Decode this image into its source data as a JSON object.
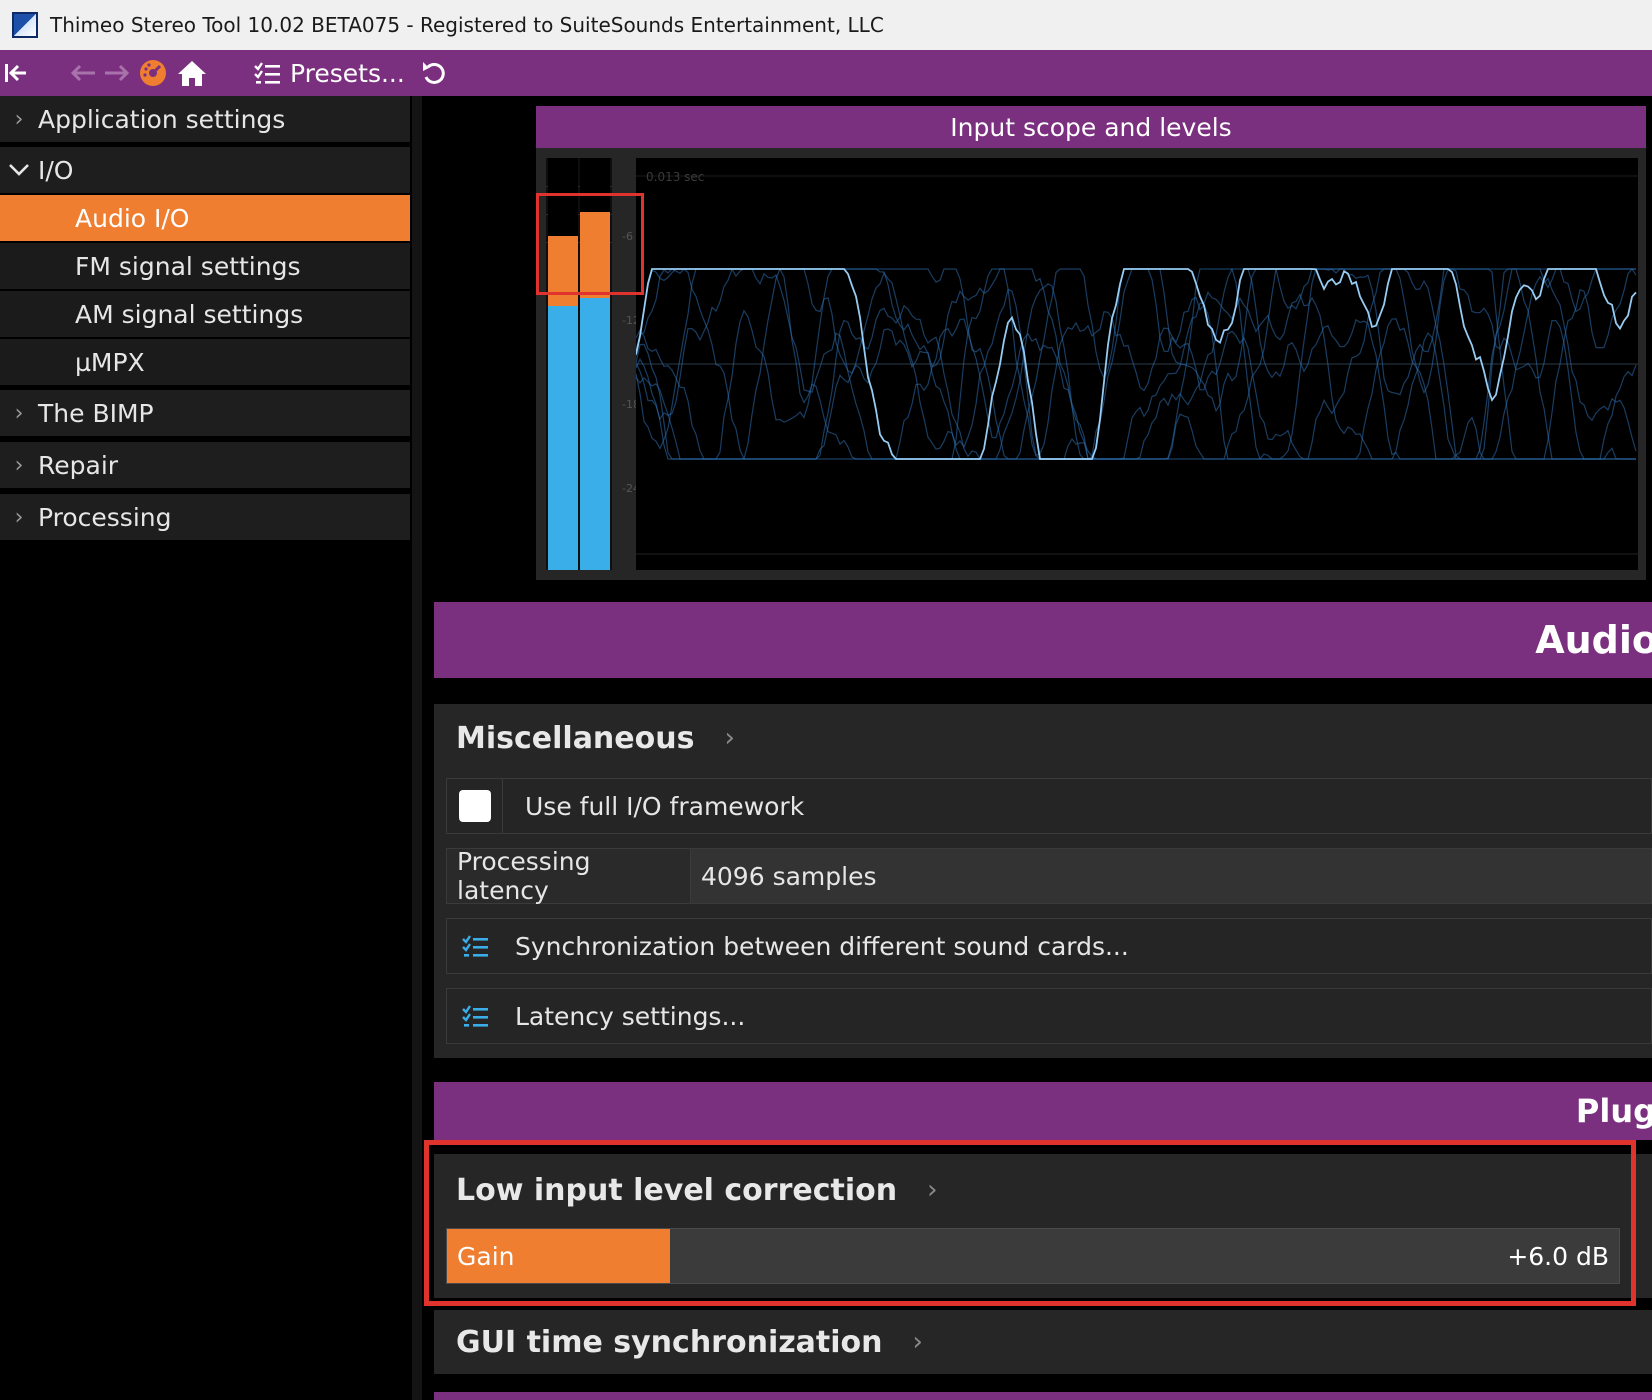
{
  "window": {
    "title": "Thimeo Stereo Tool 10.02 BETA075 - Registered to SuiteSounds Entertainment, LLC"
  },
  "toolbar": {
    "presets_label": "Presets...",
    "icons": [
      "collapse-left-icon",
      "back-arrow-icon",
      "forward-arrow-icon",
      "dial-icon",
      "home-icon",
      "list-icon",
      "undo-icon"
    ]
  },
  "sidebar": {
    "items": [
      {
        "label": "Application settings",
        "expanded": false
      },
      {
        "label": "I/O",
        "expanded": true
      },
      {
        "label": "Audio I/O",
        "active": true
      },
      {
        "label": "FM signal settings"
      },
      {
        "label": "AM signal settings"
      },
      {
        "label": "µMPX"
      },
      {
        "label": "The BIMP",
        "expanded": false
      },
      {
        "label": "Repair",
        "expanded": false
      },
      {
        "label": "Processing",
        "expanded": false
      }
    ]
  },
  "scope": {
    "title": "Input scope and levels",
    "time_label": "0.013 sec",
    "db_labels": [
      "-6",
      "-12",
      "-18",
      "-24"
    ],
    "meters": [
      {
        "level": 0.81,
        "peak": 0.64
      },
      {
        "level": 0.87,
        "peak": 0.66
      }
    ]
  },
  "sections": {
    "audio_header": "Audio",
    "plugins_header": "Plug"
  },
  "misc": {
    "title": "Miscellaneous",
    "full_io_label": "Use full I/O framework",
    "full_io_checked": false,
    "latency_label": "Processing latency",
    "latency_value": "4096 samples",
    "sync_label": "Synchronization between different sound cards...",
    "latency_settings_label": "Latency settings..."
  },
  "low_input": {
    "title": "Low input level correction",
    "gain_label": "Gain",
    "gain_value": "+6.0 dB",
    "gain_fraction": 0.19
  },
  "gui_sync": {
    "title": "GUI time synchronization"
  },
  "colors": {
    "accent_purple": "#7b2f7f",
    "accent_orange": "#ef7e30",
    "meter_blue": "#3aaee8",
    "highlight_red": "#e0332d"
  }
}
